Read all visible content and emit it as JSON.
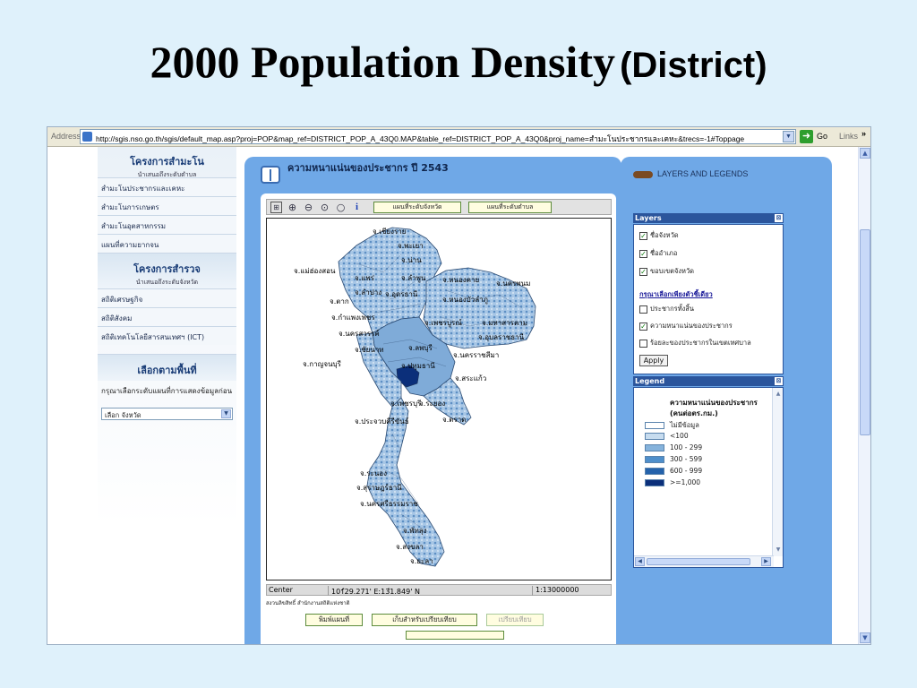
{
  "slide": {
    "title_serif": "2000 Population Density",
    "title_sans": "(District)"
  },
  "browser": {
    "address_label": "Address",
    "url": "http://sgis.nso.go.th/sgis/default_map.asp?proj=POP&map_ref=DISTRICT_POP_A_43Q0.MAP&table_ref=DISTRICT_POP_A_43Q0&proj_name=สำมะโนประชากรและเคหะ&trecs=-1#Toppage",
    "go_label": "Go",
    "links_label": "Links",
    "links_chevron": "»"
  },
  "left_panel": {
    "section1_title": "โครงการสำมะโน",
    "section1_subtitle": "นำเสนอถึงระดับตำบล",
    "section1_items": [
      "สำมะโนประชากรและเคหะ",
      "สำมะโนการเกษตร",
      "สำมะโนอุตสาหกรรม",
      "แผนที่ความยากจน"
    ],
    "section2_title": "โครงการสำรวจ",
    "section2_subtitle": "นำเสนอถึงระดับจังหวัด",
    "section2_items": [
      "สถิติเศรษฐกิจ",
      "สถิติสังคม",
      "สถิติเทคโนโลยีสารสนเทศฯ (ICT)"
    ],
    "section3_title": "เลือกตามพื้นที่",
    "note": "กรุณาเลือกระดับแผนที่การแสดงข้อมูลก่อน",
    "select_value": "เลือก จังหวัด"
  },
  "map_panel": {
    "title": "ความหนาแน่นของประชากร ปี 2543",
    "toolbar": {
      "btn_province": "แผนที่ระดับจังหวัด",
      "btn_subdistrict": "แผนที่ระดับตำบล"
    },
    "labels": [
      "จ.เชียงราย",
      "จ.พะเยา",
      "จ.น่าน",
      "จ.แม่ฮ่องสอน",
      "จ.แพร่",
      "จ.ลำพูน",
      "จ.หนองคาย",
      "จ.นครพนม",
      "จ.ลำปาง",
      "จ.อุดรธานี",
      "จ.ตาก",
      "จ.หนองบัวลำภู",
      "จ.กำแพงเพชร",
      "จ.เพชรบูรณ์",
      "จ.มหาสารคาม",
      "จ.นครสวรรค์",
      "จ.ลพบุรี",
      "จ.อุบลราชธานี",
      "จ.ชัยนาท",
      "จ.นครราชสีมา",
      "จ.กาญจนบุรี",
      "จ.ปทุมธานี",
      "จ.สระแก้ว",
      "จ.เพชรบุรี",
      "จ.ระยอง",
      "จ.ตราด",
      "จ.ประจวบคีรีขันธ์",
      "จ.ระนอง",
      "จ.สุราษฎร์ธานี",
      "จ.นครศรีธรรมราช",
      "จ.พัทลุง",
      "จ.สงขลา",
      "จ.ยะลา"
    ],
    "coords": {
      "center_label": "Center",
      "center_value": "101ํ29.271' E:13ํ1.849' N",
      "scale": "1:13000000"
    },
    "credit": "สงวนลิขสิทธิ์ สำนักงานสถิติแห่งชาติ",
    "btn_print": "พิมพ์แผนที่",
    "btn_save_compare": "เก็บสำหรับเปรียบเทียบ",
    "btn_compare": "เปรียบเทียบ"
  },
  "right_panel": {
    "header": "LAYERS AND LEGENDS",
    "layers_title": "Layers",
    "layers": [
      {
        "label": "ชื่อจังหวัด",
        "checked": true
      },
      {
        "label": "ชื่ออำเภอ",
        "checked": true
      },
      {
        "label": "ขอบเขตจังหวัด",
        "checked": true
      }
    ],
    "choose_one_note": "กรุณาเลือกเพียงตัวชี้เดียว",
    "indicators": [
      {
        "label": "ประชากรทั้งสิ้น",
        "checked": false
      },
      {
        "label": "ความหนาแน่นของประชากร",
        "checked": true
      },
      {
        "label": "ร้อยละของประชากรในเขตเทศบาล",
        "checked": false
      }
    ],
    "apply_label": "Apply",
    "legend_title": "Legend",
    "legend_heading1": "ความหนาแน่นของประชากร",
    "legend_heading2": "(คนต่อตร.กม.)",
    "legend_items": [
      {
        "label": "ไม่มีข้อมูล",
        "color": "#ffffff"
      },
      {
        "label": "<100",
        "color": "#c7dcef"
      },
      {
        "label": "100 - 299",
        "color": "#86b3dc"
      },
      {
        "label": "300 - 599",
        "color": "#4f8fcb"
      },
      {
        "label": "600 - 999",
        "color": "#2462ab"
      },
      {
        "label": ">=1,000",
        "color": "#0b2f7a"
      }
    ]
  }
}
